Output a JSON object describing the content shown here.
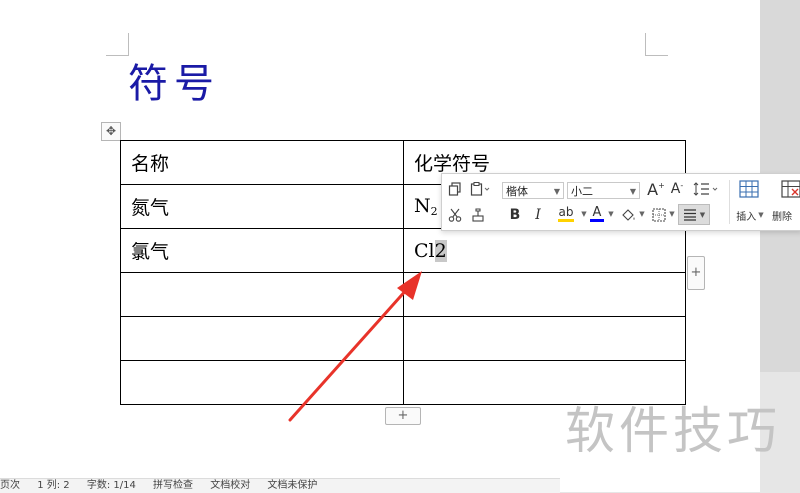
{
  "document": {
    "title": "符号",
    "table": {
      "header": [
        "名称",
        "化学符号"
      ],
      "rows": [
        {
          "name": "氮气",
          "symbol": "N",
          "symbol_sub": "2"
        },
        {
          "name": "氯气",
          "symbol": "Cl",
          "symbol_selected": "2"
        },
        {
          "name": "",
          "symbol": ""
        },
        {
          "name": "",
          "symbol": ""
        },
        {
          "name": "",
          "symbol": ""
        }
      ]
    },
    "add_row_label": "+",
    "add_col_label": "+"
  },
  "mini_toolbar": {
    "font_name": "楷体",
    "font_size": "小二",
    "insert_label": "插入",
    "delete_label": "删除",
    "bold_label": "B",
    "italic_label": "I",
    "font_color_label": "A",
    "grow_font_label": "A",
    "shrink_font_label": "A",
    "highlight_label": "ab"
  },
  "status_bar": {
    "items": [
      "页次",
      "1 列: 2",
      "字数: 1/14",
      "拼写检查",
      "文档校对",
      "文档未保护"
    ]
  },
  "watermark": "软件技巧",
  "colors": {
    "title": "#1a1aa6",
    "arrow": "#e8332a",
    "font_color_bar": "#0000ff",
    "highlight_bar": "#ffd200"
  }
}
